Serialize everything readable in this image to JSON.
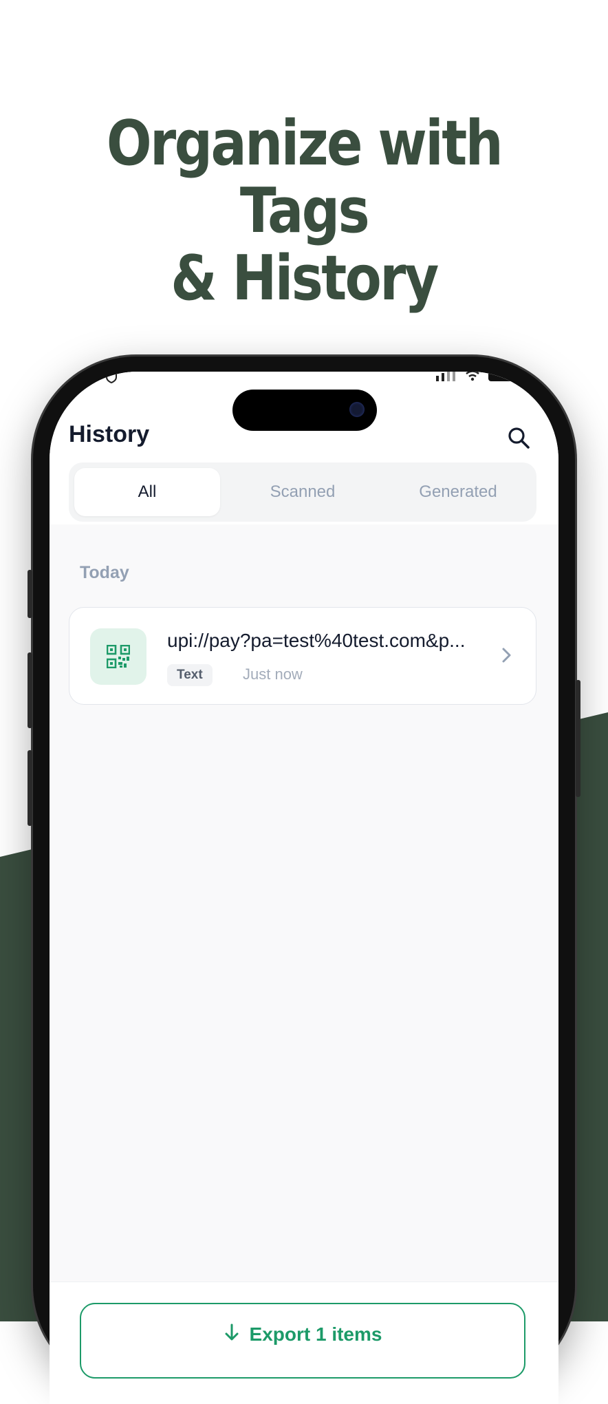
{
  "promo": {
    "headline_line1": "Organize with Tags",
    "headline_line2": "& History",
    "accent_color": "#3a4e3f"
  },
  "app": {
    "title": "History",
    "tabs": [
      {
        "label": "All",
        "active": true
      },
      {
        "label": "Scanned",
        "active": false
      },
      {
        "label": "Generated",
        "active": false
      }
    ],
    "section_label": "Today",
    "items": [
      {
        "title": "upi://pay?pa=test%40test.com&p...",
        "tag": "Text",
        "time": "Just now",
        "icon": "qr-code-icon"
      }
    ],
    "export_label": "Export 1 items",
    "brand_color": "#1c9a68"
  }
}
